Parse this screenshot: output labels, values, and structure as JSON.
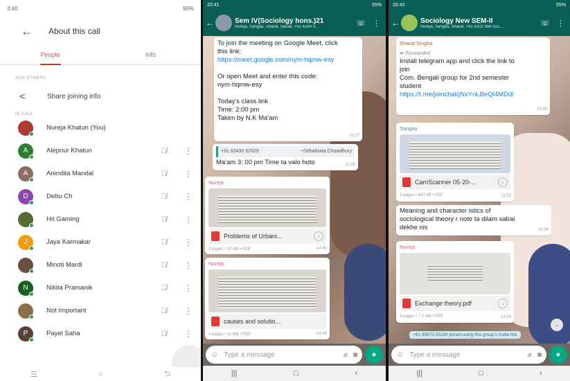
{
  "meet": {
    "status_time": "3:40",
    "status_right": "96%",
    "title": "About this call",
    "tabs": [
      "People",
      "Info"
    ],
    "section_add": "ADD OTHERS",
    "share_label": "Share joining info",
    "section_incall": "IN CALL",
    "participants": [
      {
        "name": "Nureja Khatun (You)",
        "initial": "",
        "color": "#b03a2e"
      },
      {
        "name": "Alepnur Khatun",
        "initial": "A",
        "color": "#2e7d32"
      },
      {
        "name": "Anindita Mandal",
        "initial": "A",
        "color": "#8d6e63"
      },
      {
        "name": "Debu Ch",
        "initial": "D",
        "color": "#8e44ad"
      },
      {
        "name": "Hit Gaming",
        "initial": "",
        "color": "#556b2f"
      },
      {
        "name": "Jaya Karmakar",
        "initial": "J",
        "color": "#f39c12"
      },
      {
        "name": "Minoti Mardi",
        "initial": "",
        "color": "#6d4c41"
      },
      {
        "name": "Nikita Pramanik",
        "initial": "N",
        "color": "#1b5e20"
      },
      {
        "name": "Not Important",
        "initial": "",
        "color": "#8b6f47"
      },
      {
        "name": "Payel Saha",
        "initial": "P",
        "color": "#5d4037"
      }
    ]
  },
  "chat1": {
    "status_time": "20:41",
    "status_right": "55%",
    "title": "Sem IV(Sociology hons.)21",
    "subtitle": "Nureja, Sangita, Sharat, Sonali, +91 6294 0...",
    "msg1_lines": [
      "To join the meeting on Google Meet, click",
      "this link:"
    ],
    "msg1_link": "https://meet.google.com/nym-hqmw-esy",
    "msg1_more": [
      "Or open Meet and enter this code:",
      "nym-hqmw-esy",
      "",
      "Today's class link",
      "Time: 2:00 pm",
      "Taken by N.K Ma'am"
    ],
    "msg1_time": "11:17",
    "quote_num": "+91 83430 92929",
    "quote_name": "~Debabrata Chowdhury",
    "msg2_text": "Ma'am 3: 00 pm Time ta valo hoto",
    "msg2_time": "11:58",
    "doc1_sender": "Nureja",
    "doc1_name": "Problems of Urbani...",
    "doc1_meta": "3 pages • 10 MB • PDF",
    "doc1_time": "14:45",
    "doc2_sender": "Nureja",
    "doc2_name": "causes and solutio...",
    "doc2_meta": "4 pages • 11 MB • PDF",
    "doc2_time": "14:45",
    "placeholder": "Type a message"
  },
  "chat2": {
    "status_time": "20:42",
    "status_right": "55%",
    "title": "Sociology New SEM-II",
    "subtitle": "Nureja, Sangita, Sharat, +91 6202 998 922...",
    "msg1_sender": "Sharat Singha",
    "msg1_fwd": "Forwarded",
    "msg1_lines": [
      "Install telegram app and click the link to",
      "join",
      "Com. Bengali group for 2nd semester",
      "student"
    ],
    "msg1_link": "https://t.me/joinchat/jNxYnLBeQl4MDdl",
    "msg1_time": "15:56",
    "doc1_sender": "Sangita",
    "doc1_name": "CamScanner 05-20-...",
    "doc1_meta": "3 pages • 663 kB • PDF",
    "doc1_time": "11:53",
    "msg2_lines": [
      "Meaning and character istics of",
      "sociological theory r note ta dilam sabai",
      "dekhe nis"
    ],
    "msg2_time": "11:54",
    "doc2_sender": "Nureja",
    "doc2_name": "Exchange theory.pdf",
    "doc2_meta": "4 pages • 7.2 MB • PDF",
    "doc2_time": "14:54",
    "sys": "+91 89970 55190 joined using this group's invite link",
    "placeholder": "Type a message"
  }
}
